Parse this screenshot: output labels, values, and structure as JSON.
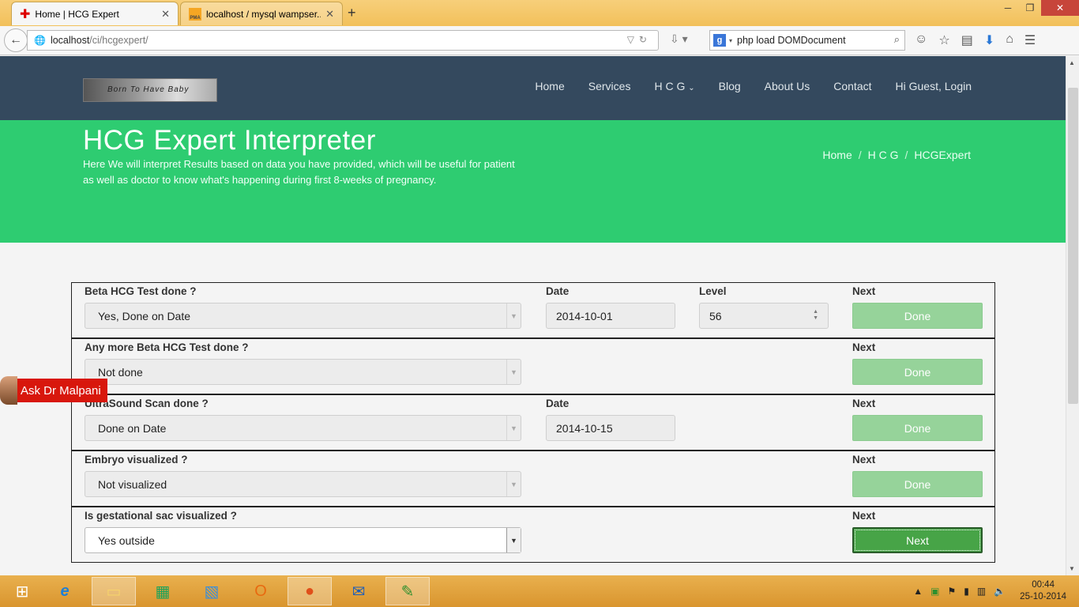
{
  "browser": {
    "tabs": [
      {
        "title": "Home | HCG Expert",
        "active": true
      },
      {
        "title": "localhost / mysql wampser...",
        "active": false
      }
    ],
    "url_host": "localhost",
    "url_path": "/ci/hcgexpert/",
    "search_text": "php load DOMDocument"
  },
  "site": {
    "logo_text": "Born To Have Baby",
    "menu": [
      "Home",
      "Services",
      "H C G",
      "Blog",
      "About Us",
      "Contact",
      "Hi Guest, Login"
    ]
  },
  "hero": {
    "title": "HCG Expert Interpreter",
    "description": "Here We will interpret Results based on data you have provided, which will be useful for patient as well as doctor to know what's happening during first 8-weeks of pregnancy.",
    "breadcrumb": [
      "Home",
      "H C G",
      "HCGExpert"
    ]
  },
  "form": {
    "rows": [
      {
        "question": "Beta HCG Test done ?",
        "answer": "Yes, Done on Date",
        "date_label": "Date",
        "date": "2014-10-01",
        "level_label": "Level",
        "level": "56",
        "next_label": "Next",
        "button": "Done"
      },
      {
        "question": "Any more Beta HCG Test done ?",
        "answer": "Not done",
        "next_label": "Next",
        "button": "Done"
      },
      {
        "question": "UltraSound Scan done ?",
        "answer": "Done on Date",
        "date_label": "Date",
        "date": "2014-10-15",
        "next_label": "Next",
        "button": "Done"
      },
      {
        "question": "Embryo visualized ?",
        "answer": "Not visualized",
        "next_label": "Next",
        "button": "Done"
      },
      {
        "question": "Is gestational sac visualized ?",
        "answer": "Yes outside",
        "next_label": "Next",
        "button": "Next"
      }
    ]
  },
  "ask_widget": {
    "label": "Ask Dr Malpani"
  },
  "taskbar": {
    "time": "00:44",
    "date": "25-10-2014"
  }
}
